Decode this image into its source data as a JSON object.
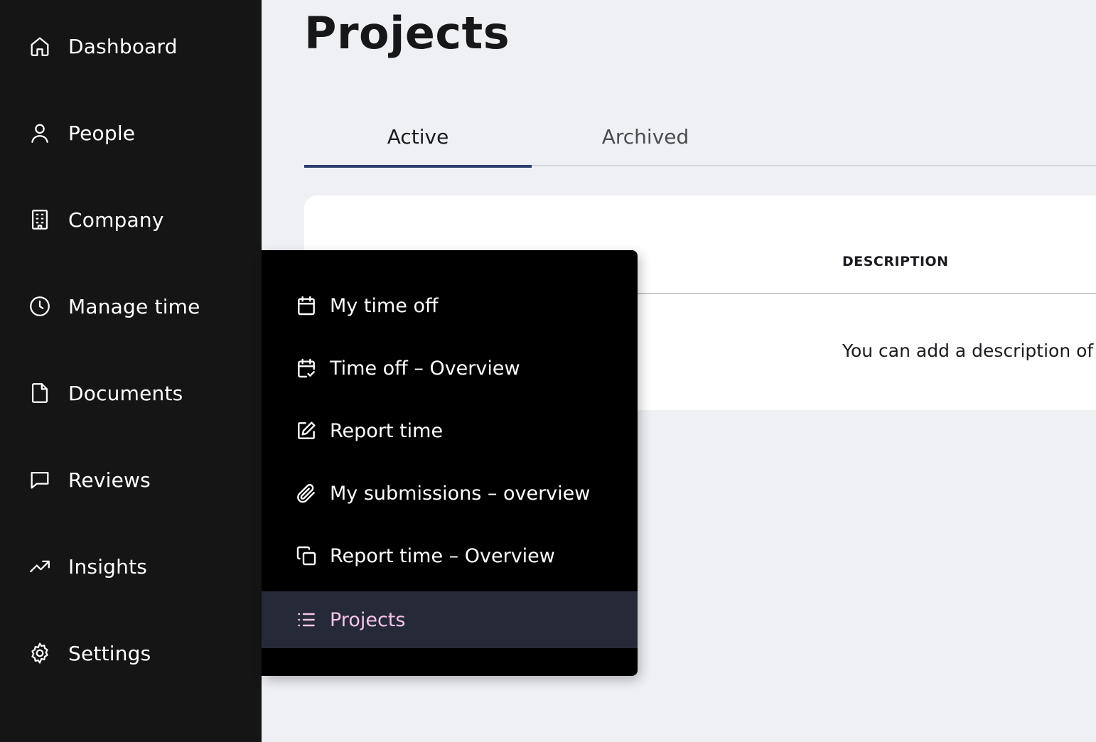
{
  "sidebar": {
    "items": [
      {
        "label": "Dashboard",
        "icon": "home-icon"
      },
      {
        "label": "People",
        "icon": "user-icon"
      },
      {
        "label": "Company",
        "icon": "building-icon"
      },
      {
        "label": "Manage time",
        "icon": "clock-icon"
      },
      {
        "label": "Documents",
        "icon": "document-icon"
      },
      {
        "label": "Reviews",
        "icon": "chat-icon"
      },
      {
        "label": "Insights",
        "icon": "trending-up-icon"
      },
      {
        "label": "Settings",
        "icon": "gear-icon"
      }
    ]
  },
  "main": {
    "title": "Projects",
    "tabs": [
      {
        "label": "Active",
        "active": true
      },
      {
        "label": "Archived",
        "active": false
      }
    ],
    "table": {
      "columns": [
        "DESCRIPTION"
      ],
      "rows": [
        {
          "description": "You can add a description of"
        }
      ]
    }
  },
  "menu": {
    "items": [
      {
        "label": "My time off",
        "icon": "calendar-icon"
      },
      {
        "label": "Time off – Overview",
        "icon": "calendar-check-icon"
      },
      {
        "label": "Report time",
        "icon": "edit-icon"
      },
      {
        "label": "My submissions – overview",
        "icon": "paperclip-icon"
      },
      {
        "label": "Report time – Overview",
        "icon": "copy-icon"
      },
      {
        "label": "Projects",
        "icon": "list-icon",
        "selected": true
      }
    ]
  },
  "colors": {
    "sidebar_bg": "#151515",
    "menu_bg": "#000000",
    "menu_selected_bg": "#262a38",
    "menu_selected_text": "#f3c4ea",
    "tab_indicator": "#2a3e6d",
    "page_bg": "#eff0f4"
  }
}
